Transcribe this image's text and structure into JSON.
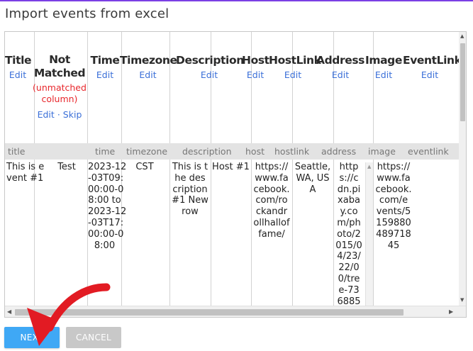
{
  "dialog": {
    "title": "Import events from excel"
  },
  "columns": [
    {
      "title": "Title",
      "edit": "Edit"
    },
    {
      "title": "Not Matched",
      "unmatched_note": "(unmatched\ncolumn)",
      "edit": "Edit",
      "separator": "·",
      "skip": "Skip"
    },
    {
      "title": "Time",
      "edit": "Edit"
    },
    {
      "title": "Timezone",
      "edit": "Edit"
    },
    {
      "title": "Description",
      "edit": "Edit"
    },
    {
      "title": "Host",
      "edit": "Edit"
    },
    {
      "title": "HostLink",
      "edit": "Edit"
    },
    {
      "title": "Address",
      "edit": "Edit"
    },
    {
      "title": "Image",
      "edit": "Edit"
    },
    {
      "title": "EventLink",
      "edit": "Edit"
    }
  ],
  "field_names": [
    "title",
    "",
    "time",
    "timezone",
    "description",
    "host",
    "hostlink",
    "address",
    "image",
    "eventlink"
  ],
  "row": [
    "This is e\nvent #1",
    "Test",
    "2023-12\n-03T09:\n00:00-0\n8:00 to\n2023-12\n-03T17:\n00:00-0\n8:00",
    "CST",
    "This is t\nhe des\ncription\n#1 New\nrow",
    "Host #1",
    "https://\nwww.fa\ncebook.\ncom/ro\nckandr\nollhallof\nfame/",
    "Seattle,\nWA, US\nA",
    "http\ns://c\ndn.pi\nxaba\ny.co\nm/ph\noto/2\n015/0\n4/23/\n22/0\n0/tre\ne-73\n6885",
    "https://\nwww.fa\ncebook.\ncom/e\nvents/5\n159880\n489718\n45",
    ""
  ],
  "buttons": {
    "next": "NEXT",
    "cancel": "CANCEL"
  },
  "icons": {
    "scroll_up": "scroll-up-arrow-icon",
    "scroll_down": "scroll-down-arrow-icon",
    "scroll_left": "scroll-left-arrow-icon",
    "scroll_right": "scroll-right-arrow-icon",
    "pointer": "red-curved-arrow-icon"
  },
  "colors": {
    "accent_bar": "#7b3fe4",
    "link": "#3a6fd8",
    "warning": "#e8262b",
    "next_button": "#3fa8f5",
    "cancel_button": "#c8c8c8",
    "annotation_arrow": "#e21b23"
  }
}
